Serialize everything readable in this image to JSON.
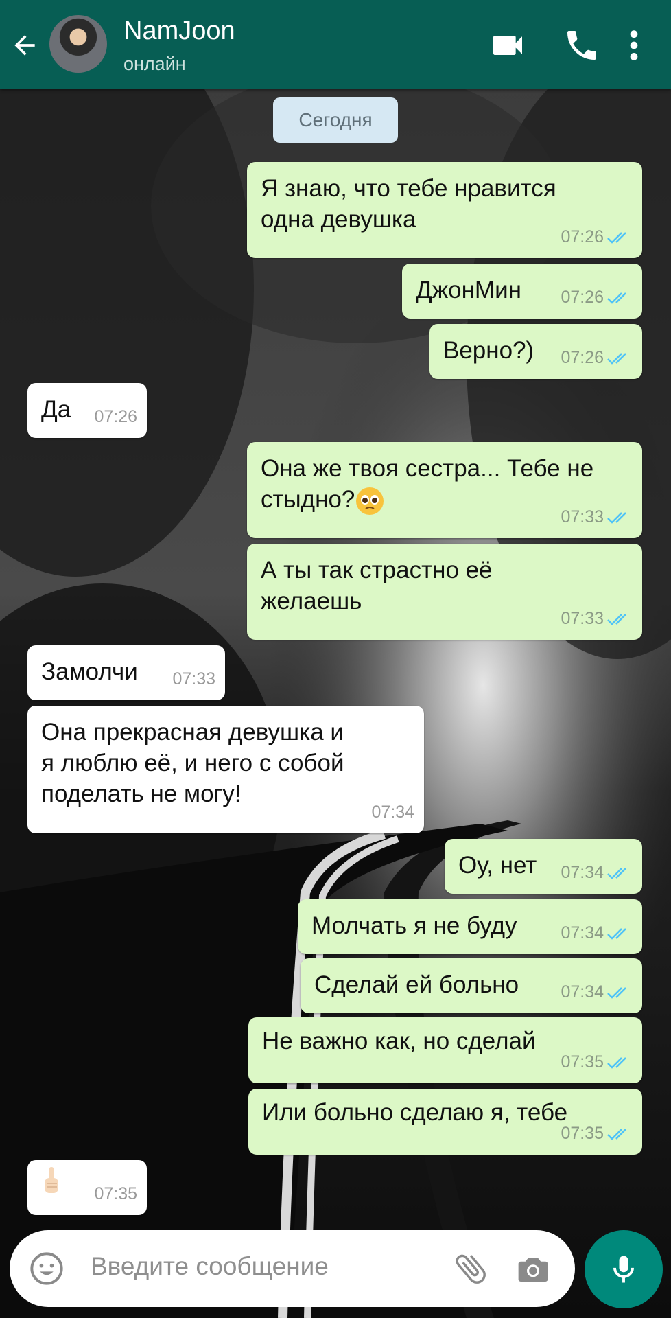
{
  "header": {
    "contact_name": "NamJoon",
    "status": "онлайн"
  },
  "chat": {
    "date_chip": "Сегодня",
    "messages": [
      {
        "dir": "out",
        "lines": [
          "Я знаю, что тебе нравится",
          "одна девушка"
        ],
        "time": "07:26"
      },
      {
        "dir": "out",
        "lines": [
          "ДжонМин"
        ],
        "time": "07:26"
      },
      {
        "dir": "out",
        "lines": [
          "Верно?)"
        ],
        "time": "07:26"
      },
      {
        "dir": "in",
        "lines": [
          "Да"
        ],
        "time": "07:26"
      },
      {
        "dir": "out",
        "lines": [
          "Она же твоя сестра... Тебе не",
          "стыдно?"
        ],
        "time": "07:33",
        "emoji": "pleading-face"
      },
      {
        "dir": "out",
        "lines": [
          "А ты так страстно её",
          "желаешь"
        ],
        "time": "07:33"
      },
      {
        "dir": "in",
        "lines": [
          "Замолчи"
        ],
        "time": "07:33"
      },
      {
        "dir": "in",
        "lines": [
          "Она прекрасная девушка и",
          "я люблю её, и него с собой",
          "поделать не могу!"
        ],
        "time": "07:34"
      },
      {
        "dir": "out",
        "lines": [
          "Оу, нет"
        ],
        "time": "07:34"
      },
      {
        "dir": "out",
        "lines": [
          "Молчать я не буду"
        ],
        "time": "07:34"
      },
      {
        "dir": "out",
        "lines": [
          "Сделай ей больно"
        ],
        "time": "07:34"
      },
      {
        "dir": "out",
        "lines": [
          "Не важно как, но сделай"
        ],
        "time": "07:35"
      },
      {
        "dir": "out",
        "lines": [
          "Или больно сделаю я, тебе"
        ],
        "time": "07:35"
      },
      {
        "dir": "in",
        "lines": [
          ""
        ],
        "time": "07:35",
        "emoji": "index-pointing-up"
      }
    ]
  },
  "input": {
    "placeholder": "Введите сообщение"
  },
  "colors": {
    "header": "#075e54",
    "outgoing_bubble": "#dcf8c6",
    "incoming_bubble": "#ffffff",
    "read_tick": "#4fc3f7",
    "mic_button": "#00897b"
  }
}
